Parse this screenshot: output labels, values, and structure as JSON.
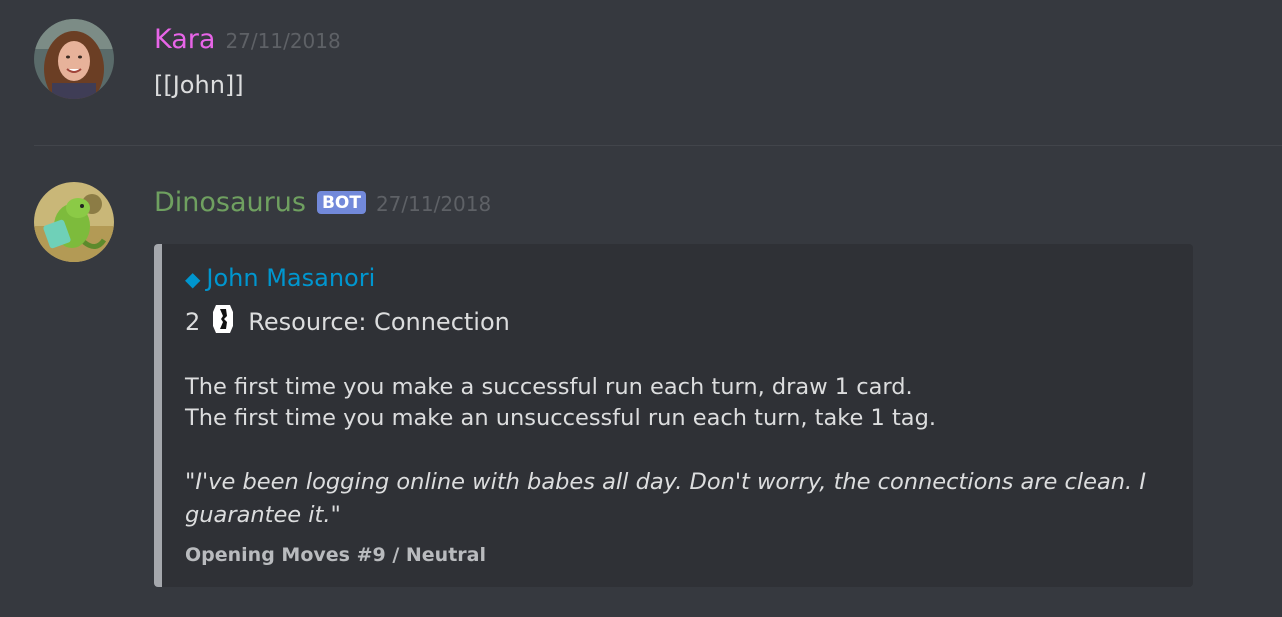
{
  "messages": [
    {
      "author": "Kara",
      "timestamp": "27/11/2018",
      "text": "[[John]]",
      "author_color": "#e865e8"
    },
    {
      "author": "Dinosaurus",
      "bot_tag": "BOT",
      "timestamp": "27/11/2018",
      "author_color": "#6fa060",
      "embed": {
        "title_icon": "diamond-icon",
        "title": "John Masanori",
        "cost": "2",
        "cost_icon": "credit-icon",
        "type_line": "Resource: Connection",
        "text_lines": [
          "The first time you make a successful run each turn, draw 1 card.",
          "The first time you make an unsuccessful run each turn, take 1 tag."
        ],
        "flavor": "\"I've been logging online with babes all day. Don't worry, the connections are clean. I guarantee it.\"",
        "footer": "Opening Moves #9 / Neutral",
        "border_color": "#a5a8ad",
        "title_color": "#0096cf"
      }
    }
  ]
}
